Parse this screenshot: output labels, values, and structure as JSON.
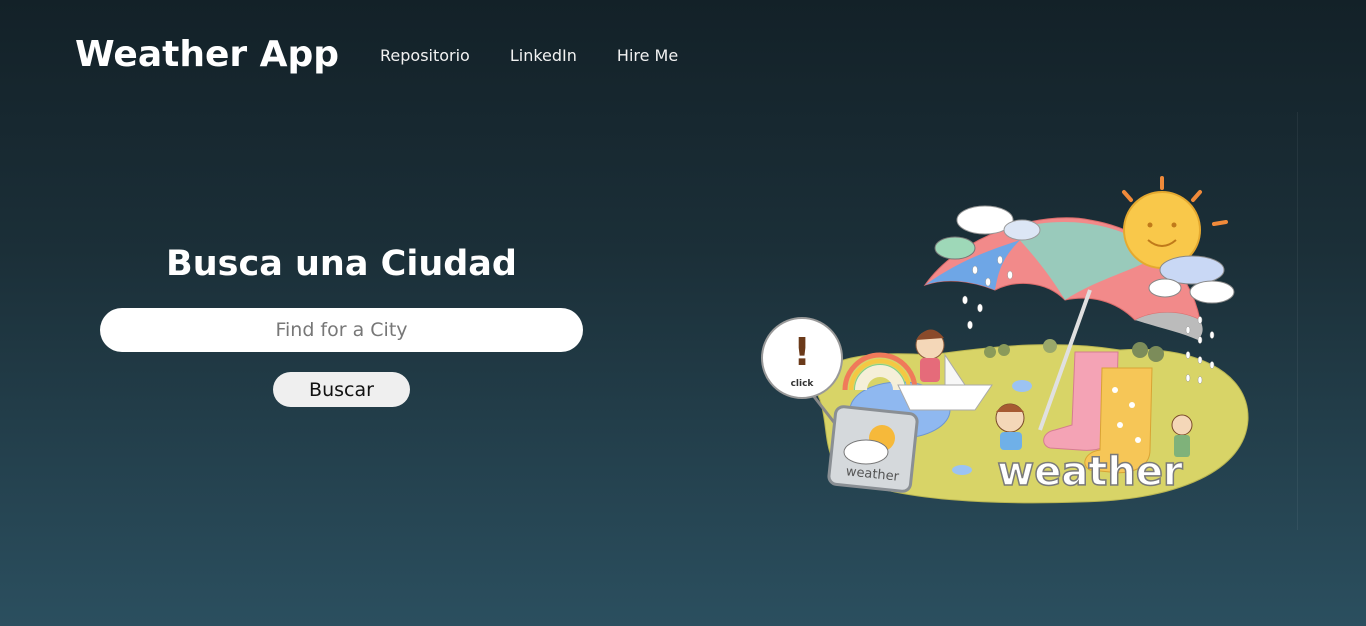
{
  "navbar": {
    "brand": "Weather App",
    "links": [
      "Repositorio",
      "LinkedIn",
      "Hire Me"
    ]
  },
  "search": {
    "title": "Busca una Ciudad",
    "placeholder": "Find for a City",
    "value": "",
    "button_label": "Buscar"
  },
  "illustration": {
    "badge_text": "click",
    "sign_text": "weather",
    "ground_text": "weather",
    "colors": {
      "background_top": "#132128",
      "background_bottom": "#2b4f5f",
      "ground": "#d8d467",
      "umbrella": "#f28a8a",
      "sun": "#f9c84a"
    }
  }
}
